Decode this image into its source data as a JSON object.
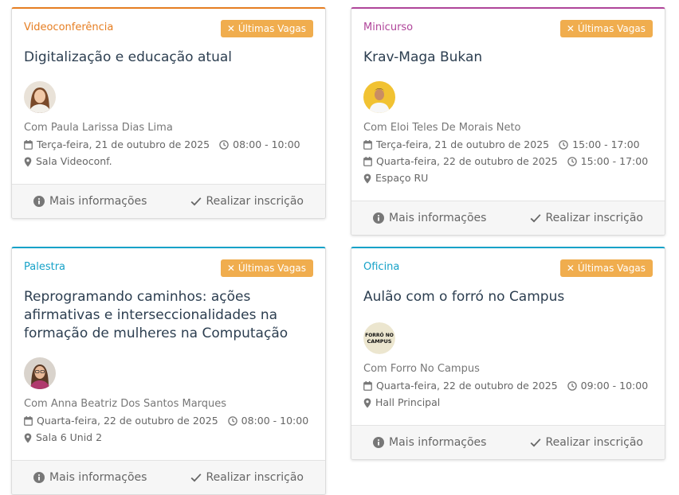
{
  "badge_label": "Últimas Vagas",
  "footer": {
    "info_label": "Mais informações",
    "enroll_label": "Realizar inscrição"
  },
  "cards": [
    {
      "category": "Videoconferência",
      "category_color": "#e67e22",
      "title": "Digitalização e educação atual",
      "speaker": "Com Paula Larissa Dias Lima",
      "sessions": [
        {
          "date": "Terça-feira, 21 de outubro de 2025",
          "time": "08:00 - 10:00"
        }
      ],
      "location": "Sala Videoconf.",
      "avatar": "photo-woman-brown-hair"
    },
    {
      "category": "Minicurso",
      "category_color": "#b0459a",
      "title": "Krav-Maga Bukan",
      "speaker": "Com Eloi Teles De Morais Neto",
      "sessions": [
        {
          "date": "Terça-feira, 21 de outubro de 2025",
          "time": "15:00 - 17:00"
        },
        {
          "date": "Quarta-feira, 22 de outubro de 2025",
          "time": "15:00 - 17:00"
        }
      ],
      "location": "Espaço RU",
      "avatar": "photo-man-yellow-background"
    },
    {
      "category": "Palestra",
      "category_color": "#17a2c8",
      "title": "Reprogramando caminhos: ações afirmativas e interseccionalidades na formação de mulheres na Computação",
      "speaker": "Com Anna Beatriz Dos Santos Marques",
      "sessions": [
        {
          "date": "Quarta-feira, 22 de outubro de 2025",
          "time": "08:00 - 10:00"
        }
      ],
      "location": "Sala 6 Unid 2",
      "avatar": "photo-woman-glasses"
    },
    {
      "category": "Oficina",
      "category_color": "#17a2c8",
      "title": "Aulão com o forró no Campus",
      "speaker": "Com Forro No Campus",
      "sessions": [
        {
          "date": "Quarta-feira, 22 de outubro de 2025",
          "time": "09:00 - 10:00"
        }
      ],
      "location": "Hall Principal",
      "avatar": "logo-forro-no-campus",
      "avatar_logo_text": [
        "FORRÓ NO",
        "CAMPUS"
      ]
    }
  ]
}
